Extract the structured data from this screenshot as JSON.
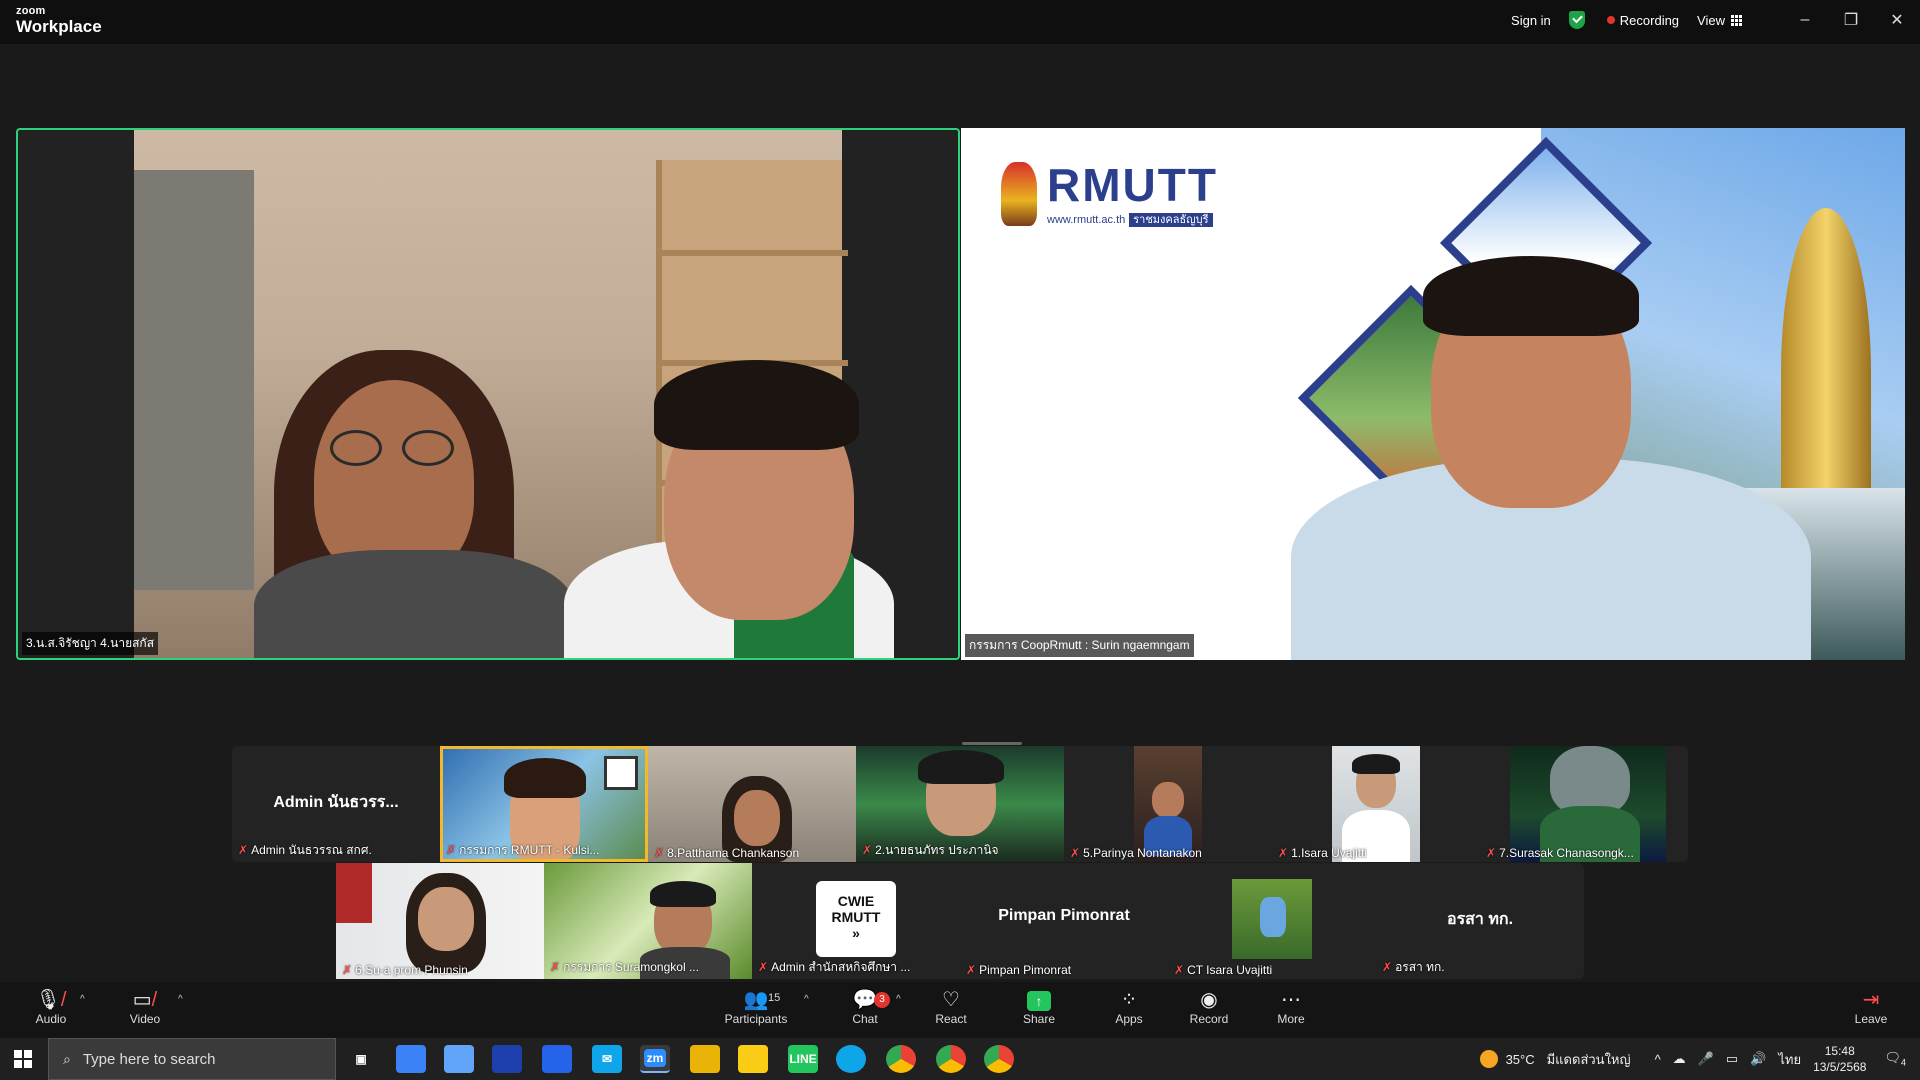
{
  "titlebar": {
    "brand_small": "zoom",
    "brand_big": "Workplace",
    "sign_in": "Sign in",
    "recording": "Recording",
    "view": "View",
    "minimize": "–",
    "restore": "❐",
    "close": "✕"
  },
  "main_tiles": {
    "left_name": "3.น.ส.จิรัชญา 4.นายสกัส",
    "right_name": "กรรมการ CoopRmutt : Surin ngaemngam",
    "rmutt_logo": "RMUTT",
    "rmutt_url": "www.rmutt.ac.th",
    "rmutt_tag": "ราชมงคลธัญบุรี"
  },
  "gallery": {
    "row1": [
      {
        "name": "Admin นันธวรรณ สกศ.",
        "big_name": "Admin นันธวรร..."
      },
      {
        "name": "กรรมการ RMUTT - Kulsi..."
      },
      {
        "name": "8.Patthama Chankanson"
      },
      {
        "name": "2.นายธนภัทร ประภานิจ"
      },
      {
        "name": "5.Parinya Nontanakon"
      },
      {
        "name": "1.Isara Uvajitti"
      },
      {
        "name": "7.Surasak Chanasongk..."
      }
    ],
    "row2": [
      {
        "name": "6.Su-a prom Phunsin"
      },
      {
        "name": "กรรมการ Suramongkol ..."
      },
      {
        "name": "Admin สำนักสหกิจศึกษา ...",
        "logo_line1": "CWIE",
        "logo_line2": "RMUTT",
        "logo_arrow": "»"
      },
      {
        "name": "Pimpan Pimonrat",
        "big_name": "Pimpan Pimonrat"
      },
      {
        "name": "CT Isara Uvajitti"
      },
      {
        "name": "อรสา ทก.",
        "big_name": "อรสา ทก."
      }
    ]
  },
  "toolbar": {
    "audio": "Audio",
    "video": "Video",
    "participants": "Participants",
    "participants_count": "15",
    "chat": "Chat",
    "chat_badge": "3",
    "react": "React",
    "share": "Share",
    "apps": "Apps",
    "record": "Record",
    "more": "More",
    "leave": "Leave"
  },
  "taskbar": {
    "search_placeholder": "Type here to search",
    "temperature": "35°C",
    "weather_text": "มีแดดส่วนใหญ่",
    "language": "ไทย",
    "time": "15:48",
    "date": "13/5/2568",
    "notifications": "4"
  },
  "colors": {
    "active_speaker": "#2ed27a",
    "recording_dot": "#e3342f",
    "share_green": "#22c55e",
    "muted_red": "#ff4d4d",
    "rmutt_blue": "#2b3f8c"
  }
}
